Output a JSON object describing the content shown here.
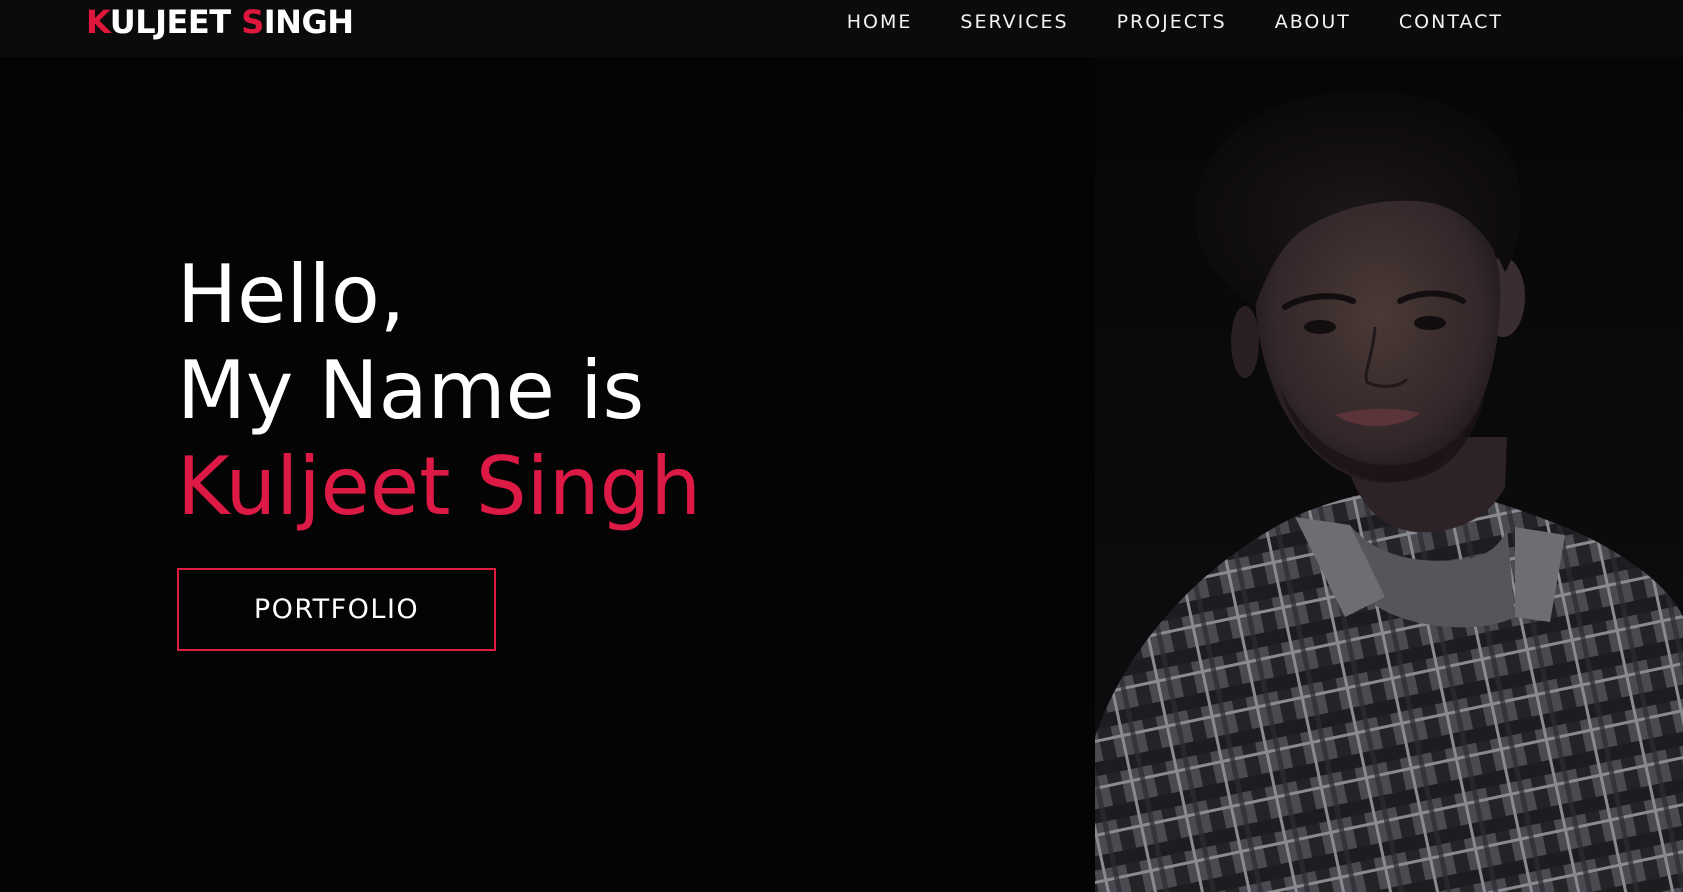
{
  "brand": {
    "logo_first_initial": "K",
    "logo_first_rest": "ULJEET",
    "logo_last_initial": "S",
    "logo_last_rest": "INGH",
    "accent_color": "#e0173c"
  },
  "nav": {
    "items": [
      {
        "label": "HOME"
      },
      {
        "label": "SERVICES"
      },
      {
        "label": "PROJECTS"
      },
      {
        "label": "ABOUT"
      },
      {
        "label": "CONTACT"
      }
    ]
  },
  "hero": {
    "greeting": "Hello,",
    "intro": "My Name is",
    "name": "Kuljeet Singh",
    "button_label": "PORTFOLIO"
  }
}
